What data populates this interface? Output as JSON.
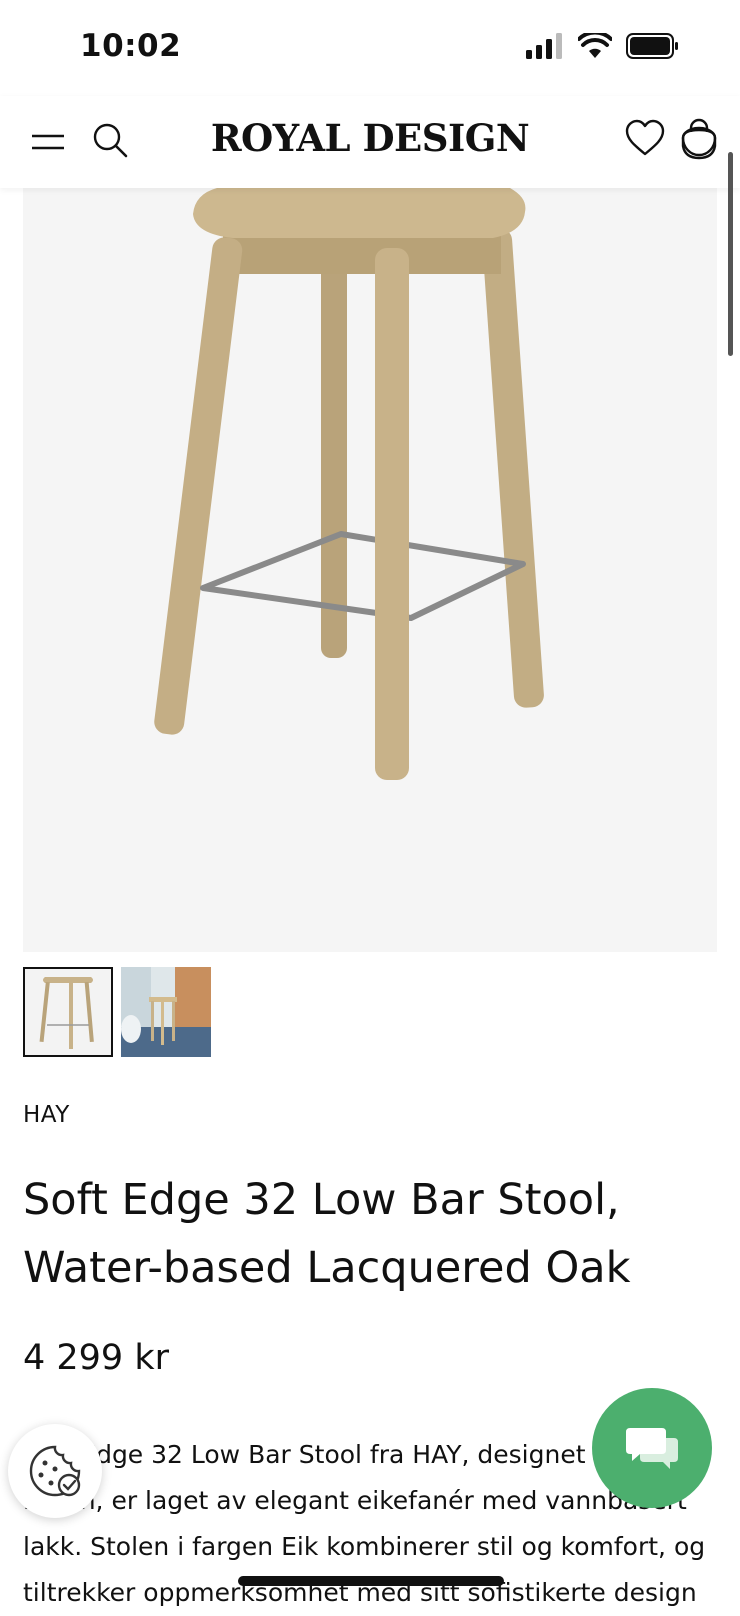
{
  "status": {
    "time": "10:02"
  },
  "header": {
    "logo": "ROYAL DESIGN"
  },
  "product": {
    "brand": "HAY",
    "title": "Soft Edge 32 Low Bar Stool, Water-based Lacquered Oak",
    "price": "4 299 kr",
    "description": "Soft Edge 32 Low Bar Stool fra HAY, designet av Iskos-Berlin, er laget av elegant eikefanér med vannbasert lakk. Stolen i fargen Eik kombinerer stil og komfort, og tiltrekker oppmerksomhet med sitt sofistikerte design",
    "thumbnails": [
      "stool-product-photo",
      "stool-in-kitchen-photo"
    ]
  },
  "colors": {
    "accent_chat": "#4caf6e",
    "wood": "#c9b48c",
    "background": "#f5f5f5"
  }
}
